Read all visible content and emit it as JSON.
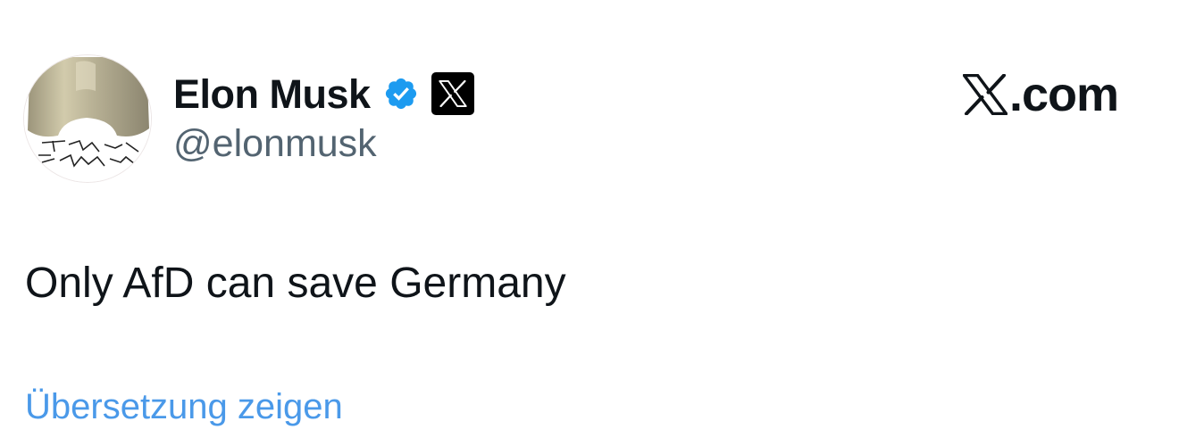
{
  "tweet": {
    "display_name": "Elon Musk",
    "handle": "@elonmusk",
    "text": "Only AfD can save Germany",
    "translate_label": "Übersetzung zeigen",
    "verified": true,
    "verified_icon": "verified-badge-icon",
    "affiliate_icon": "x-logo-icon",
    "avatar_icon": "profile-avatar"
  },
  "brand": {
    "label": ".com",
    "icon": "x-logo-icon"
  },
  "colors": {
    "text": "#0f1419",
    "secondary": "#536471",
    "link": "#4a99e9",
    "verified": "#1d9bf0"
  }
}
